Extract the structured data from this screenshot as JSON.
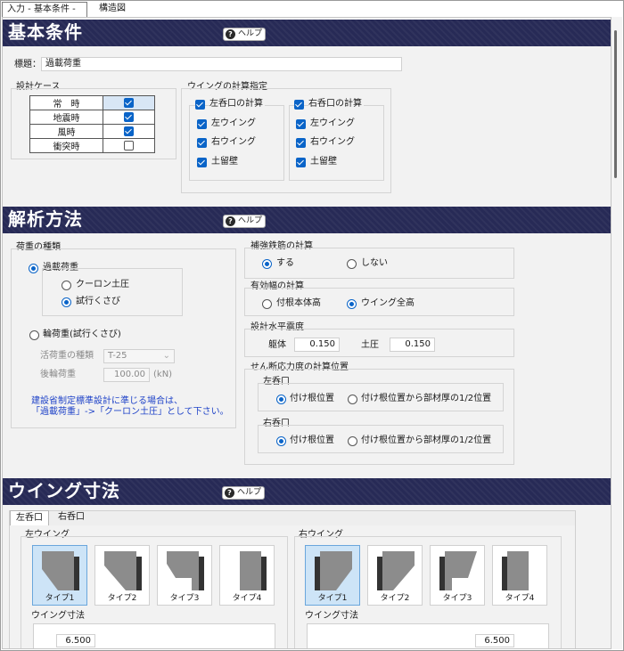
{
  "tabs": [
    "入力 - 基本条件 -",
    "構造図"
  ],
  "help_label": "ヘルプ",
  "sections": {
    "basic": "基本条件",
    "analysis": "解析方法",
    "wing_dim": "ウイング寸法"
  },
  "basic": {
    "title_label": "標題：",
    "title_value": "過載荷重",
    "design_case": {
      "label": "設計ケース",
      "rows": [
        {
          "name": "常　時",
          "checked": true
        },
        {
          "name": "地震時",
          "checked": true
        },
        {
          "name": "風時",
          "checked": true
        },
        {
          "name": "衝突時",
          "checked": false
        }
      ]
    },
    "wing_calc": {
      "label": "ウイングの計算指定",
      "left": {
        "label": "左呑口の計算",
        "items": [
          "左ウイング",
          "右ウイング",
          "土留壁"
        ]
      },
      "right": {
        "label": "右呑口の計算",
        "items": [
          "左ウイング",
          "右ウイング",
          "土留壁"
        ]
      }
    }
  },
  "analysis": {
    "load_type": {
      "label": "荷重の種類",
      "option_overload": "過載荷重",
      "sub_coulomb": "クーロン土圧",
      "sub_trial": "試行くさび",
      "option_wheel": "輪荷重(試行くさび)",
      "live_load_label": "活荷重の種類",
      "live_load_value": "T-25",
      "rear_wheel_label": "後輪荷重",
      "rear_wheel_value": "100.00",
      "rear_wheel_unit": "(kN)",
      "note_line1": "建設省制定標準設計に準じる場合は、",
      "note_line2": "「過載荷重」->「クーロン土圧」として下さい。"
    },
    "rebar": {
      "label": "補強鉄筋の計算",
      "yes": "する",
      "no": "しない"
    },
    "eff_width": {
      "label": "有効幅の計算",
      "opt1": "付根本体高",
      "opt2": "ウイング全高"
    },
    "seismic": {
      "label": "設計水平震度",
      "body_label": "躯体",
      "body_value": "0.150",
      "soil_label": "土圧",
      "soil_value": "0.150"
    },
    "shear": {
      "label": "せん断応力度の計算位置",
      "left_label": "左呑口",
      "right_label": "右呑口",
      "opt1": "付け根位置",
      "opt2": "付け根位置から部材厚の1/2位置"
    }
  },
  "wing_dim": {
    "tabs": [
      "左呑口",
      "右呑口"
    ],
    "left_group": "左ウイング",
    "right_group": "右ウイング",
    "types": [
      "タイプ1",
      "タイプ2",
      "タイプ3",
      "タイプ4"
    ],
    "dim_label": "ウイング寸法",
    "left_value": "6.500",
    "right_value": "6.500"
  },
  "colors": {
    "header_bg": "#272a56",
    "accent": "#0a64c8",
    "note": "#1f43c8",
    "selected_tile": "#cde4f7"
  }
}
